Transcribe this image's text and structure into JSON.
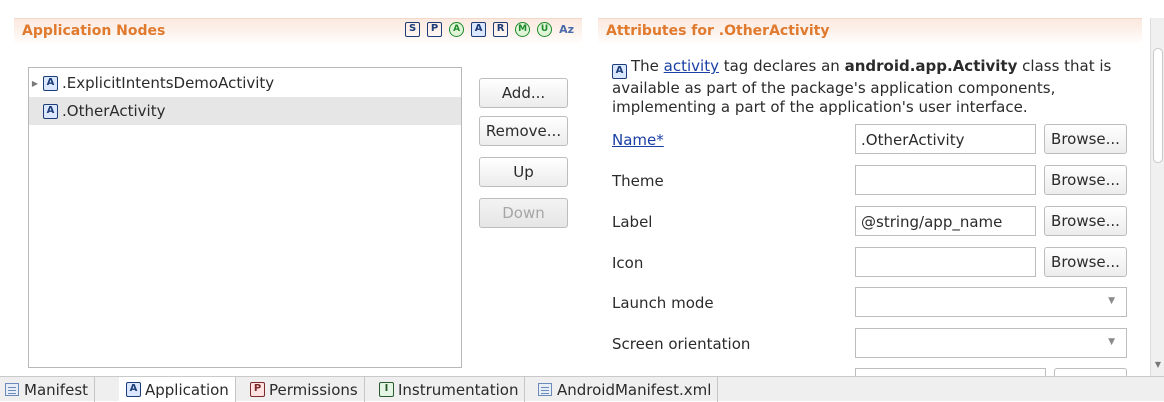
{
  "application_nodes": {
    "title": "Application Nodes",
    "filter_icons": [
      {
        "letter": "S",
        "shape": "square",
        "name": "filter-s-icon"
      },
      {
        "letter": "P",
        "shape": "square",
        "name": "filter-p-icon"
      },
      {
        "letter": "A",
        "shape": "circle",
        "name": "filter-a-circle-icon"
      },
      {
        "letter": "A",
        "shape": "square",
        "name": "filter-a-icon"
      },
      {
        "letter": "R",
        "shape": "square",
        "name": "filter-r-icon"
      },
      {
        "letter": "M",
        "shape": "circle",
        "name": "filter-m-icon"
      },
      {
        "letter": "U",
        "shape": "circle",
        "name": "filter-u-icon"
      }
    ],
    "sort_label": "Az",
    "tree": [
      {
        "label": ".ExplicitIntentsDemoActivity",
        "icon": "A",
        "expandable": true,
        "selected": false
      },
      {
        "label": ".OtherActivity",
        "icon": "A",
        "expandable": false,
        "selected": true
      }
    ],
    "buttons": {
      "add": "Add...",
      "remove": "Remove...",
      "up": "Up",
      "down": "Down"
    }
  },
  "attributes": {
    "title": "Attributes for .OtherActivity",
    "description": {
      "icon": "A",
      "prefix": "The ",
      "link": "activity",
      "middle": " tag declares an ",
      "bold": "android.app.Activity",
      "suffix": " class that is available as part of the package's application components, implementing a part of the application's user interface."
    },
    "browse_label": "Browse...",
    "fields": {
      "name": {
        "label": "Name*",
        "value": ".OtherActivity"
      },
      "theme": {
        "label": "Theme",
        "value": ""
      },
      "label": {
        "label": "Label",
        "value": "@string/app_name"
      },
      "icon": {
        "label": "Icon",
        "value": ""
      },
      "launch_mode": {
        "label": "Launch mode",
        "value": ""
      },
      "screen_orientation": {
        "label": "Screen orientation",
        "value": ""
      }
    }
  },
  "tabs": [
    {
      "label": "Manifest",
      "icon": "manifest-icon"
    },
    {
      "label": "Application",
      "icon": "A",
      "active": true
    },
    {
      "label": "Permissions",
      "icon": "P"
    },
    {
      "label": "Instrumentation",
      "icon": "I"
    },
    {
      "label": "AndroidManifest.xml",
      "icon": "xml-file-icon"
    }
  ]
}
